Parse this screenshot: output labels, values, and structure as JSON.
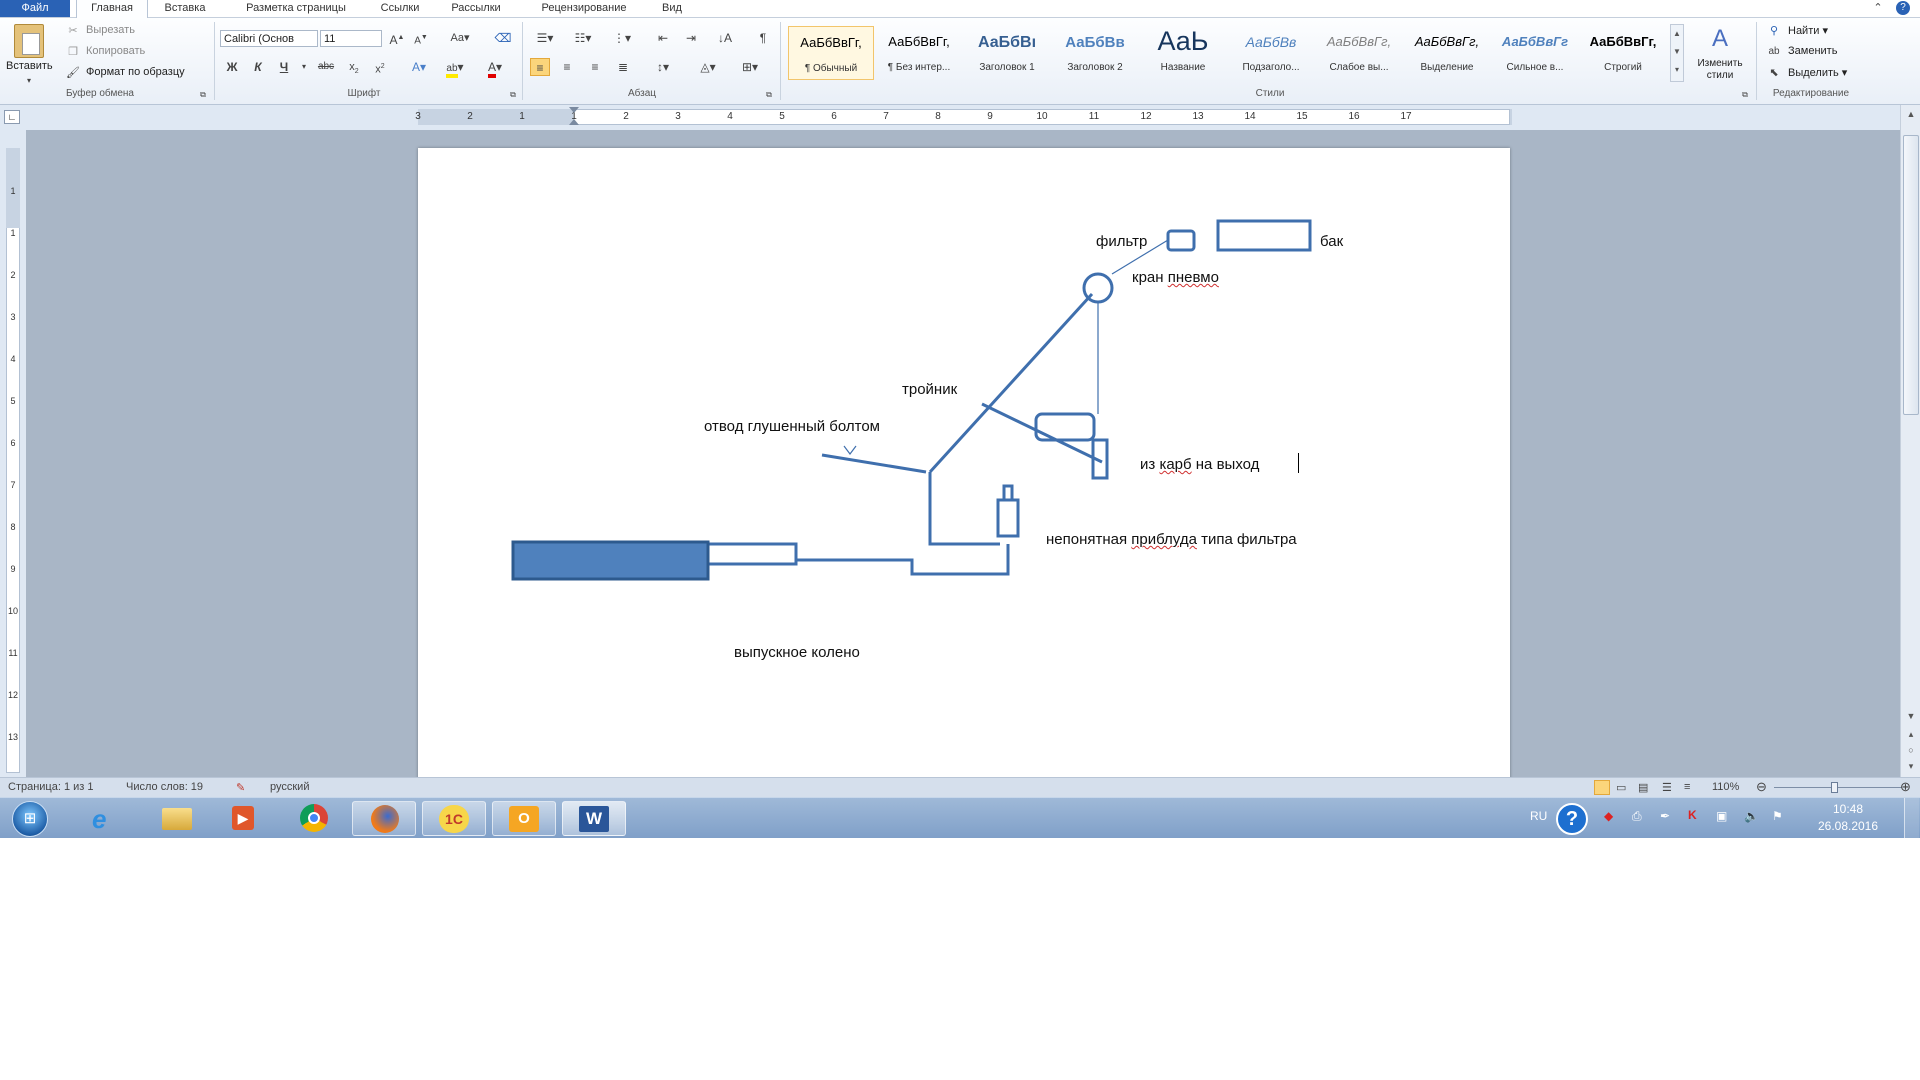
{
  "tabs": [
    "Файл",
    "Главная",
    "Вставка",
    "Разметка страницы",
    "Ссылки",
    "Рассылки",
    "Рецензирование",
    "Вид"
  ],
  "clipboard": {
    "paste_label": "Вставить",
    "cut": "Вырезать",
    "copy": "Копировать",
    "format_painter": "Формат по образцу",
    "group_label": "Буфер обмена"
  },
  "font": {
    "family": "Calibri (Основ",
    "size": "11",
    "group_label": "Шрифт",
    "bold": "Ж",
    "italic": "К",
    "underline": "Ч"
  },
  "paragraph": {
    "group_label": "Абзац"
  },
  "styles": {
    "items": [
      {
        "sample": "АаБбВвГг,",
        "name": "¶ Обычный"
      },
      {
        "sample": "АаБбВвГг,",
        "name": "¶ Без интер..."
      },
      {
        "sample": "АаБбВı",
        "name": "Заголовок 1"
      },
      {
        "sample": "АаБбВв",
        "name": "Заголовок 2"
      },
      {
        "sample": "АаЬ",
        "name": "Название"
      },
      {
        "sample": "АаБбВв",
        "name": "Подзаголо..."
      },
      {
        "sample": "АаБбВвГг,",
        "name": "Слабое вы..."
      },
      {
        "sample": "АаБбВвГг,",
        "name": "Выделение"
      },
      {
        "sample": "АаБбВвГг",
        "name": "Сильное в..."
      },
      {
        "sample": "АаБбВвГг,",
        "name": "Строгий"
      }
    ],
    "change_styles": "Изменить стили",
    "group_label": "Стили"
  },
  "editing": {
    "find": "Найти",
    "replace": "Заменить",
    "select": "Выделить",
    "group_label": "Редактирование"
  },
  "ruler_numbers": [
    "3",
    "2",
    "1",
    "1",
    "2",
    "3",
    "4",
    "5",
    "6",
    "7",
    "8",
    "9",
    "10",
    "11",
    "12",
    "13",
    "14",
    "15",
    "16",
    "17"
  ],
  "vruler_numbers": [
    "1",
    "1",
    "2",
    "3",
    "4",
    "5",
    "6",
    "7",
    "8",
    "9",
    "10",
    "11",
    "12",
    "13"
  ],
  "diagram": {
    "labels": {
      "filter": "фильтр",
      "tank": "бак",
      "valve": "кран пневмо",
      "tee": "тройник",
      "plug": "отвод глушенный  болтом",
      "carb": "из  карб на выход",
      "device": "непонятная приблуда типа фильтра",
      "exhaust": "выпускное колено"
    },
    "line_color": "#3f6fad",
    "fill_color": "#4f81bd"
  },
  "status": {
    "page": "Страница: 1 из 1",
    "words": "Число слов: 19",
    "language": "русский",
    "zoom": "110%"
  },
  "taskbar": {
    "lang": "RU",
    "time": "10:48",
    "date": "26.08.2016"
  }
}
